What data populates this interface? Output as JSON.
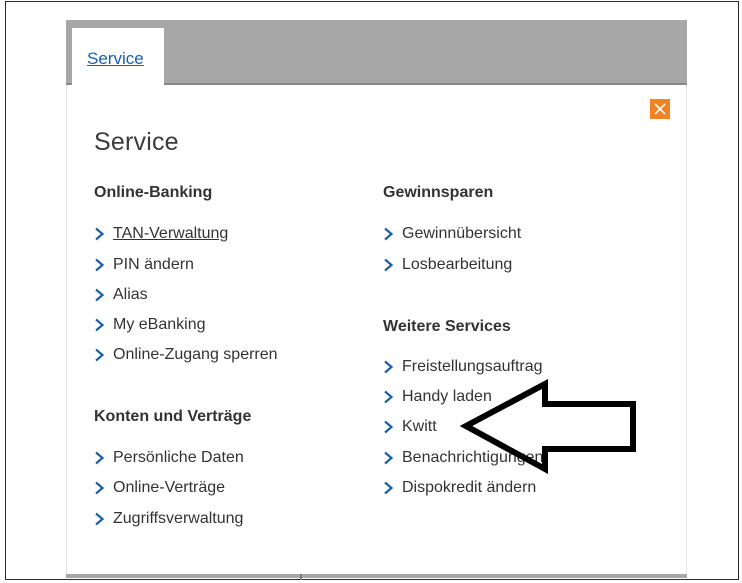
{
  "tab": {
    "label": "Service"
  },
  "panel": {
    "title": "Service",
    "close_icon": "close-icon",
    "accent_color": "#f58220"
  },
  "columns": {
    "left": {
      "sections": [
        {
          "heading": "Online-Banking",
          "items": [
            "TAN-Verwaltung",
            "PIN ändern",
            "Alias",
            "My eBanking",
            "Online-Zugang sperren"
          ]
        },
        {
          "heading": "Konten und Verträge",
          "items": [
            "Persönliche Daten",
            "Online-Verträge",
            "Zugriffsverwaltung"
          ]
        }
      ]
    },
    "right": {
      "sections": [
        {
          "heading": "Gewinnsparen",
          "items": [
            "Gewinnübersicht",
            "Losbearbeitung"
          ]
        },
        {
          "heading": "Weitere Services",
          "items": [
            "Freistellungsauftrag",
            "Handy laden",
            "Kwitt",
            "Benachrichtigungen",
            "Dispokredit ändern"
          ]
        }
      ]
    }
  },
  "link_chevron_icon": "chevron-right-icon",
  "link_color": "#1a5fa8"
}
